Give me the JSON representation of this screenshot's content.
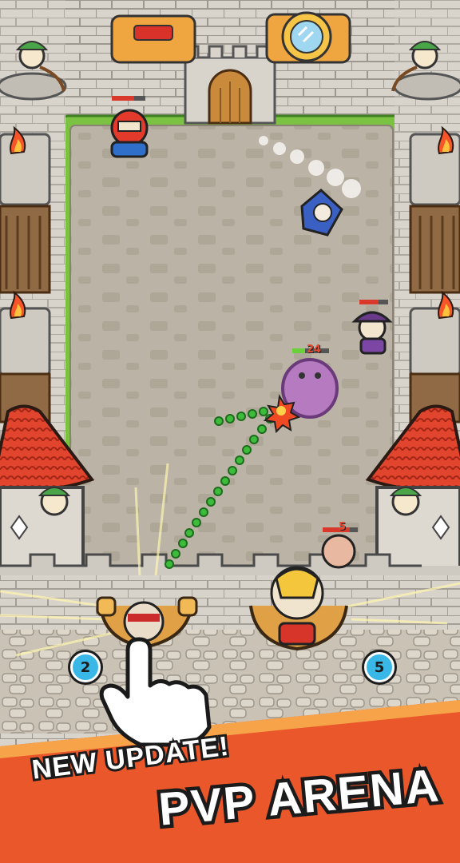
{
  "promo": {
    "line1": "NEW UPDATE!",
    "line2": "PVP ARENA"
  },
  "slingshots": {
    "left_count": "2",
    "right_count": "5"
  },
  "enemies": {
    "ogre_hp": "24",
    "dwarf_hp": "5"
  },
  "colors": {
    "arena_floor": "#b9b1a4",
    "grass": "#7cc242",
    "roof": "#e2452d",
    "banner": "#e9572a",
    "badge": "#39b7e6",
    "trajectory": "#3dbb3b"
  },
  "icons": [
    "pointer-hand-icon",
    "fire-icon",
    "explosion-icon",
    "magic-mirror-icon"
  ]
}
